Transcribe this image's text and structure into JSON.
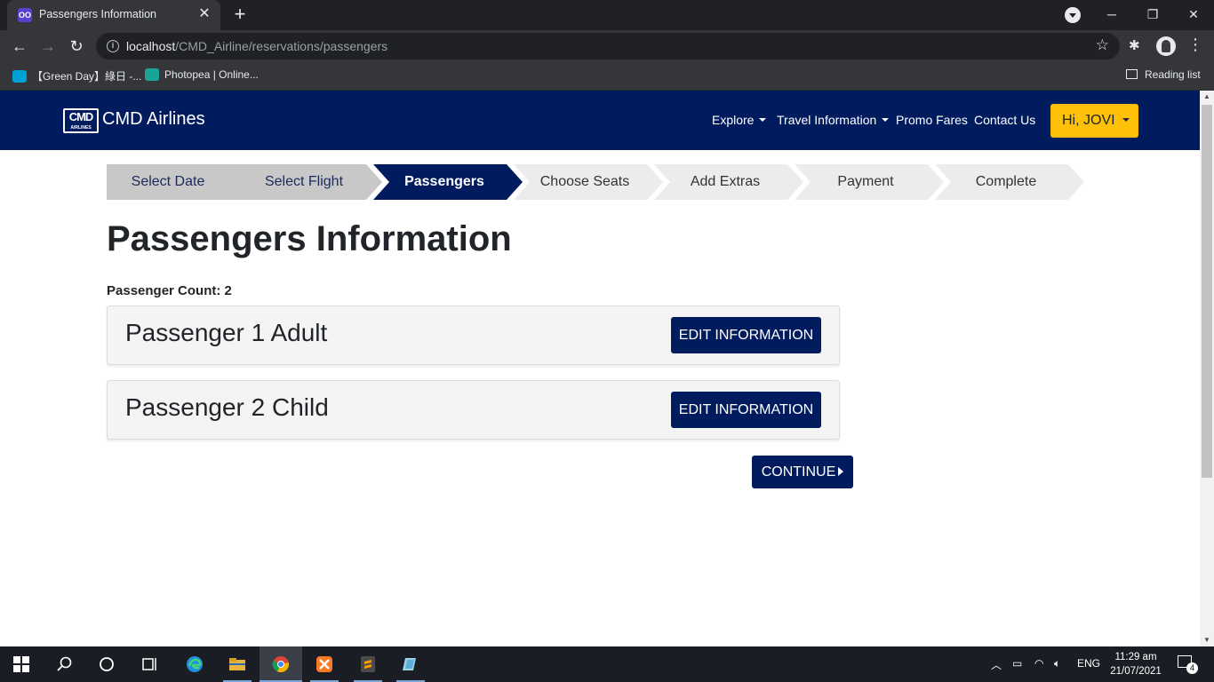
{
  "browser": {
    "tab_title": "Passengers Information",
    "tab_favicon": "OO",
    "url_host": "localhost",
    "url_path": "/CMD_Airline/reservations/passengers",
    "bookmarks": [
      {
        "label": "【Green Day】綠日 -...",
        "icon": "bilibili-icon",
        "color": "#00a1d6"
      },
      {
        "label": "Photopea | Online...",
        "icon": "photopea-icon",
        "color": "#18a497"
      }
    ],
    "reading_list": "Reading list"
  },
  "navbar": {
    "logo_text": "CMD",
    "logo_sub": "AIRLINES",
    "brand": "CMD Airlines",
    "links": [
      {
        "label": "Explore",
        "dropdown": true
      },
      {
        "label": "Travel Information",
        "dropdown": true
      },
      {
        "label": "Promo Fares",
        "dropdown": false
      },
      {
        "label": "Contact Us",
        "dropdown": false
      }
    ],
    "user_button": "Hi, JOVI"
  },
  "steps": [
    {
      "label": "Select Date",
      "state": "done"
    },
    {
      "label": "Select Flight",
      "state": "done"
    },
    {
      "label": "Passengers",
      "state": "active"
    },
    {
      "label": "Choose Seats",
      "state": "todo"
    },
    {
      "label": "Add Extras",
      "state": "todo"
    },
    {
      "label": "Payment",
      "state": "todo"
    },
    {
      "label": "Complete",
      "state": "todo"
    }
  ],
  "main": {
    "title": "Passengers Information",
    "count_label": "Passenger Count: 2",
    "passengers": [
      {
        "name": "Passenger 1 Adult",
        "button": "EDIT INFORMATION"
      },
      {
        "name": "Passenger 2 Child",
        "button": "EDIT INFORMATION"
      }
    ],
    "continue_label": "CONTINUE"
  },
  "taskbar": {
    "lang": "ENG",
    "time": "11:29 am",
    "date": "21/07/2021",
    "notifications": "4"
  },
  "colors": {
    "navy": "#001b5e",
    "yellow": "#ffc107",
    "step_done": "#c8c8c8",
    "step_todo": "#ececec"
  }
}
